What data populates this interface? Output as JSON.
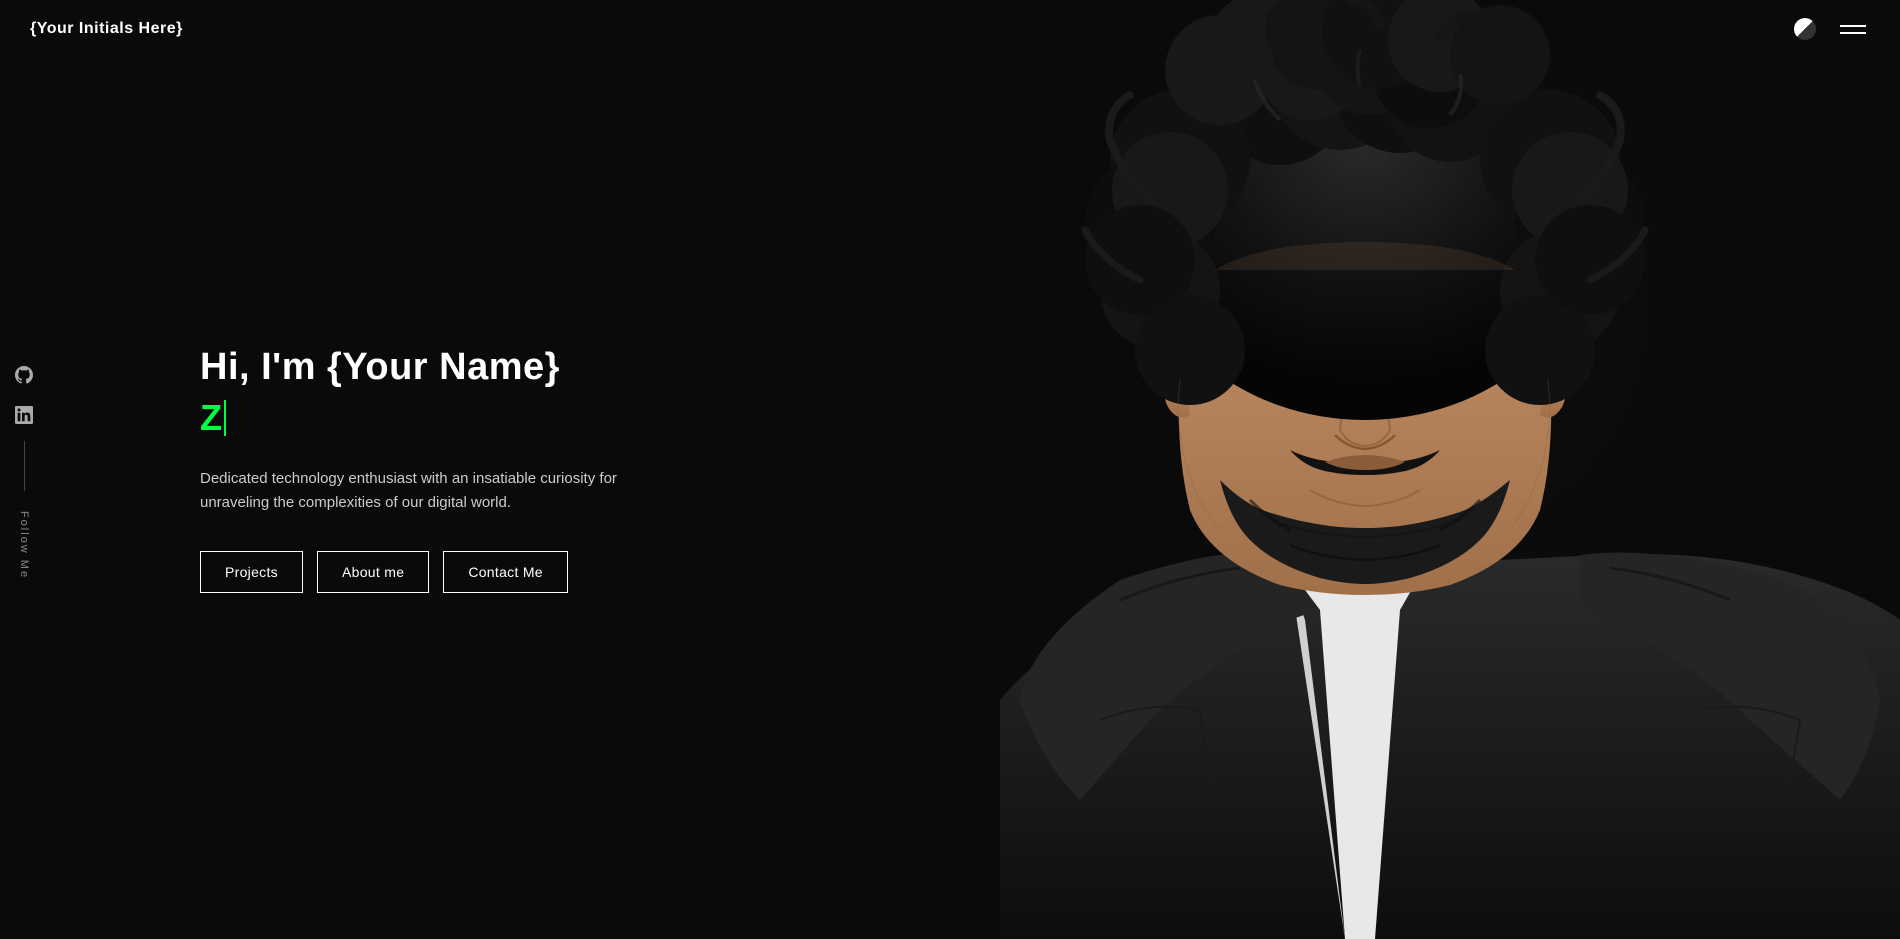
{
  "header": {
    "logo": "{Your Initials Here}",
    "theme_toggle_label": "Toggle theme",
    "hamburger_label": "Menu"
  },
  "sidebar": {
    "follow_label": "Follow Me",
    "social_links": [
      {
        "name": "github",
        "icon": "github-icon",
        "url": "#"
      },
      {
        "name": "linkedin",
        "icon": "linkedin-icon",
        "url": "#"
      }
    ]
  },
  "hero": {
    "greeting": "Hi, I'm {Your Name}",
    "typed_text": "Z|",
    "description": "Dedicated technology enthusiast with an insatiable curiosity for unraveling the complexities of our digital world.",
    "buttons": [
      {
        "label": "Projects",
        "name": "projects-button"
      },
      {
        "label": "About me",
        "name": "about-me-button"
      },
      {
        "label": "Contact Me",
        "name": "contact-me-button"
      }
    ]
  },
  "colors": {
    "background": "#0a0a0a",
    "text_primary": "#ffffff",
    "text_secondary": "#cccccc",
    "accent_green": "#00ff41",
    "border": "#ffffff"
  }
}
